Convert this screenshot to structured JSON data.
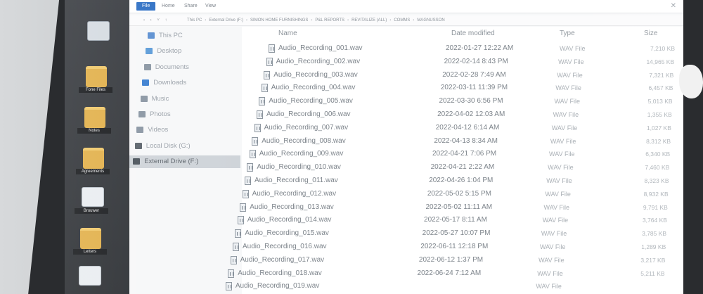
{
  "ribbon": {
    "tabs": [
      "File",
      "Home",
      "Share",
      "View"
    ]
  },
  "address": {
    "nav": "‹  ›  ˅  ↑",
    "path": [
      "This PC",
      "External Drive (F:)",
      "SIMON HOME FURNISHINGS",
      "P&L REPORTS",
      "REVITALIZE (ALL)",
      "COMMS",
      "MAGNUSSON"
    ]
  },
  "sidebar": {
    "items": [
      {
        "label": "This PC",
        "icon": "monitor-icon",
        "color": "#5b8fd1"
      },
      {
        "label": "Desktop",
        "icon": "desktop-icon",
        "color": "#5b9bd8"
      },
      {
        "label": "Documents",
        "icon": "document-icon",
        "color": "#8a96a3"
      },
      {
        "label": "Downloads",
        "icon": "download-icon",
        "color": "#3b7fd0"
      },
      {
        "label": "Music",
        "icon": "music-icon",
        "color": "#8a96a3"
      },
      {
        "label": "Photos",
        "icon": "photo-icon",
        "color": "#8a96a3"
      },
      {
        "label": "Videos",
        "icon": "video-icon",
        "color": "#8a96a3"
      },
      {
        "label": "Local Disk (G:)",
        "icon": "disk-icon",
        "color": "#5b636b"
      },
      {
        "label": "External Drive (F:)",
        "icon": "drive-icon",
        "color": "#4b535b"
      }
    ],
    "selected_index": 8
  },
  "columns": {
    "name": "Name",
    "date": "Date modified",
    "type": "Type",
    "size": "Size"
  },
  "files": [
    {
      "name": "Audio_Recording_001.wav",
      "date": "2022-01-27 12:22 AM",
      "type": "WAV File",
      "size": "7,210 KB"
    },
    {
      "name": "Audio_Recording_002.wav",
      "date": "2022-02-14 8:43 PM",
      "type": "WAV File",
      "size": "14,965 KB"
    },
    {
      "name": "Audio_Recording_003.wav",
      "date": "2022-02-28 7:49 AM",
      "type": "WAV File",
      "size": "7,321 KB"
    },
    {
      "name": "Audio_Recording_004.wav",
      "date": "2022-03-11 11:39 PM",
      "type": "WAV File",
      "size": "6,457 KB"
    },
    {
      "name": "Audio_Recording_005.wav",
      "date": "2022-03-30 6:56 PM",
      "type": "WAV File",
      "size": "5,013 KB"
    },
    {
      "name": "Audio_Recording_006.wav",
      "date": "2022-04-02 12:03 AM",
      "type": "WAV File",
      "size": "1,355 KB"
    },
    {
      "name": "Audio_Recording_007.wav",
      "date": "2022-04-12 6:14 AM",
      "type": "WAV File",
      "size": "1,027 KB"
    },
    {
      "name": "Audio_Recording_008.wav",
      "date": "2022-04-13 8:34 AM",
      "type": "WAV File",
      "size": "8,312 KB"
    },
    {
      "name": "Audio_Recording_009.wav",
      "date": "2022-04-21 7:06 PM",
      "type": "WAV File",
      "size": "6,340 KB"
    },
    {
      "name": "Audio_Recording_010.wav",
      "date": "2022-04-21 2:22 AM",
      "type": "WAV File",
      "size": "7,460 KB"
    },
    {
      "name": "Audio_Recording_011.wav",
      "date": "2022-04-26 1:04 PM",
      "type": "WAV File",
      "size": "8,323 KB"
    },
    {
      "name": "Audio_Recording_012.wav",
      "date": "2022-05-02 5:15 PM",
      "type": "WAV File",
      "size": "8,932 KB"
    },
    {
      "name": "Audio_Recording_013.wav",
      "date": "2022-05-02 11:11 AM",
      "type": "WAV File",
      "size": "9,791 KB"
    },
    {
      "name": "Audio_Recording_014.wav",
      "date": "2022-05-17 8:11 AM",
      "type": "WAV File",
      "size": "3,764 KB"
    },
    {
      "name": "Audio_Recording_015.wav",
      "date": "2022-05-27 10:07 PM",
      "type": "WAV File",
      "size": "3,785 KB"
    },
    {
      "name": "Audio_Recording_016.wav",
      "date": "2022-06-11 12:18 PM",
      "type": "WAV File",
      "size": "1,289 KB"
    },
    {
      "name": "Audio_Recording_017.wav",
      "date": "2022-06-12 1:37 PM",
      "type": "WAV File",
      "size": "3,217 KB"
    },
    {
      "name": "Audio_Recording_018.wav",
      "date": "2022-06-24 7:12 AM",
      "type": "WAV File",
      "size": "5,211 KB"
    },
    {
      "name": "Audio_Recording_019.wav",
      "date": "",
      "type": "WAV File",
      "size": ""
    }
  ],
  "desktop": {
    "icons": [
      {
        "kind": "drive",
        "caption": ""
      },
      {
        "kind": "folder",
        "caption": "Fone Files"
      },
      {
        "kind": "folder",
        "caption": "Notes"
      },
      {
        "kind": "folder",
        "caption": "Agreements"
      },
      {
        "kind": "file",
        "caption": "Brouwer"
      },
      {
        "kind": "folder",
        "caption": "Letters"
      },
      {
        "kind": "file",
        "caption": ""
      }
    ]
  }
}
